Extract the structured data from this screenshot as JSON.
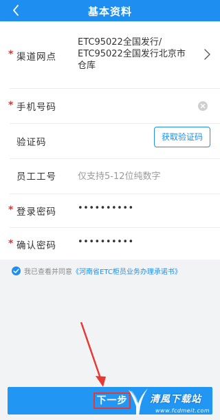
{
  "header": {
    "title": "基本资料"
  },
  "form": {
    "required_mark": "*",
    "channel": {
      "label": "渠道网点",
      "value_line1": "ETC95022全国发行/",
      "value_line2": "ETC95022全国发行北京市",
      "value_line3": "仓库"
    },
    "phone": {
      "label": "手机号码",
      "value": ""
    },
    "verify_code": {
      "label": "验证码",
      "button_label": "获取验证码"
    },
    "employee_id": {
      "label": "员工工号",
      "placeholder": "仅支持5-12位纯数字"
    },
    "login_password": {
      "label": "登录密码",
      "value": "••••••••••"
    },
    "confirm_password": {
      "label": "确认密码",
      "value": "••••••••••"
    }
  },
  "agreement": {
    "prefix": "我已查看并同意",
    "link": "《河南省ETC柜员业务办理承诺书》",
    "checked": true
  },
  "footer": {
    "next_label": "下一步"
  },
  "watermark": {
    "text": "清風下载站",
    "url": "www.fcdmeit.com"
  },
  "colors": {
    "primary": "#1e8ff0",
    "required": "#e0322f",
    "highlight_box": "#e53935"
  }
}
